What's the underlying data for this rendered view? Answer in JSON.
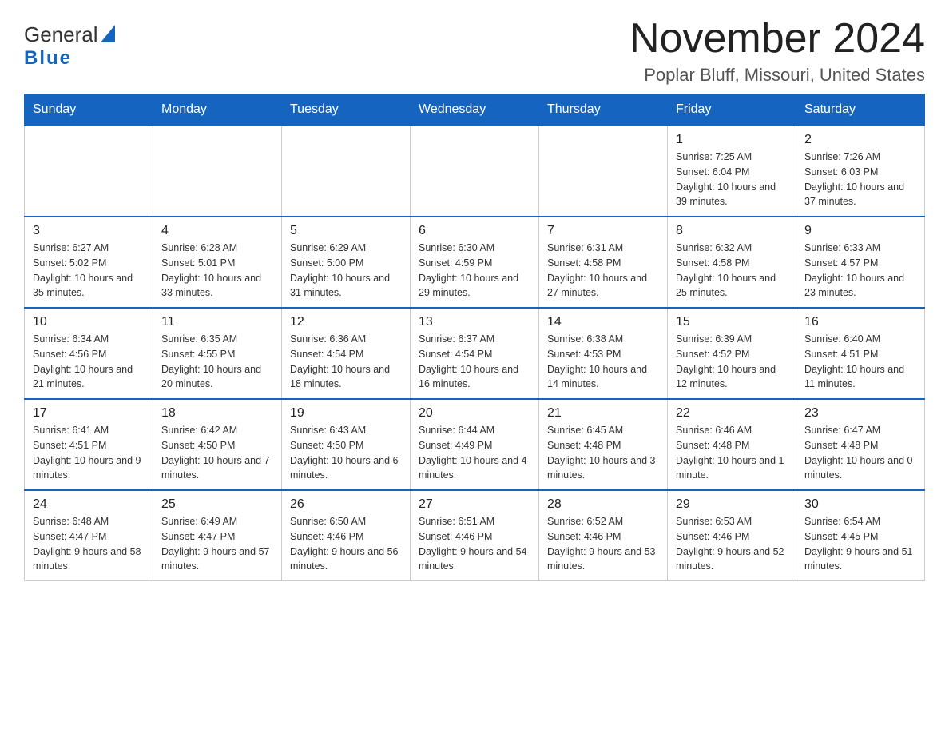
{
  "header": {
    "logo_general": "General",
    "logo_blue": "Blue",
    "title": "November 2024",
    "subtitle": "Poplar Bluff, Missouri, United States"
  },
  "calendar": {
    "days_of_week": [
      "Sunday",
      "Monday",
      "Tuesday",
      "Wednesday",
      "Thursday",
      "Friday",
      "Saturday"
    ],
    "weeks": [
      [
        {
          "day": "",
          "info": ""
        },
        {
          "day": "",
          "info": ""
        },
        {
          "day": "",
          "info": ""
        },
        {
          "day": "",
          "info": ""
        },
        {
          "day": "",
          "info": ""
        },
        {
          "day": "1",
          "info": "Sunrise: 7:25 AM\nSunset: 6:04 PM\nDaylight: 10 hours and 39 minutes."
        },
        {
          "day": "2",
          "info": "Sunrise: 7:26 AM\nSunset: 6:03 PM\nDaylight: 10 hours and 37 minutes."
        }
      ],
      [
        {
          "day": "3",
          "info": "Sunrise: 6:27 AM\nSunset: 5:02 PM\nDaylight: 10 hours and 35 minutes."
        },
        {
          "day": "4",
          "info": "Sunrise: 6:28 AM\nSunset: 5:01 PM\nDaylight: 10 hours and 33 minutes."
        },
        {
          "day": "5",
          "info": "Sunrise: 6:29 AM\nSunset: 5:00 PM\nDaylight: 10 hours and 31 minutes."
        },
        {
          "day": "6",
          "info": "Sunrise: 6:30 AM\nSunset: 4:59 PM\nDaylight: 10 hours and 29 minutes."
        },
        {
          "day": "7",
          "info": "Sunrise: 6:31 AM\nSunset: 4:58 PM\nDaylight: 10 hours and 27 minutes."
        },
        {
          "day": "8",
          "info": "Sunrise: 6:32 AM\nSunset: 4:58 PM\nDaylight: 10 hours and 25 minutes."
        },
        {
          "day": "9",
          "info": "Sunrise: 6:33 AM\nSunset: 4:57 PM\nDaylight: 10 hours and 23 minutes."
        }
      ],
      [
        {
          "day": "10",
          "info": "Sunrise: 6:34 AM\nSunset: 4:56 PM\nDaylight: 10 hours and 21 minutes."
        },
        {
          "day": "11",
          "info": "Sunrise: 6:35 AM\nSunset: 4:55 PM\nDaylight: 10 hours and 20 minutes."
        },
        {
          "day": "12",
          "info": "Sunrise: 6:36 AM\nSunset: 4:54 PM\nDaylight: 10 hours and 18 minutes."
        },
        {
          "day": "13",
          "info": "Sunrise: 6:37 AM\nSunset: 4:54 PM\nDaylight: 10 hours and 16 minutes."
        },
        {
          "day": "14",
          "info": "Sunrise: 6:38 AM\nSunset: 4:53 PM\nDaylight: 10 hours and 14 minutes."
        },
        {
          "day": "15",
          "info": "Sunrise: 6:39 AM\nSunset: 4:52 PM\nDaylight: 10 hours and 12 minutes."
        },
        {
          "day": "16",
          "info": "Sunrise: 6:40 AM\nSunset: 4:51 PM\nDaylight: 10 hours and 11 minutes."
        }
      ],
      [
        {
          "day": "17",
          "info": "Sunrise: 6:41 AM\nSunset: 4:51 PM\nDaylight: 10 hours and 9 minutes."
        },
        {
          "day": "18",
          "info": "Sunrise: 6:42 AM\nSunset: 4:50 PM\nDaylight: 10 hours and 7 minutes."
        },
        {
          "day": "19",
          "info": "Sunrise: 6:43 AM\nSunset: 4:50 PM\nDaylight: 10 hours and 6 minutes."
        },
        {
          "day": "20",
          "info": "Sunrise: 6:44 AM\nSunset: 4:49 PM\nDaylight: 10 hours and 4 minutes."
        },
        {
          "day": "21",
          "info": "Sunrise: 6:45 AM\nSunset: 4:48 PM\nDaylight: 10 hours and 3 minutes."
        },
        {
          "day": "22",
          "info": "Sunrise: 6:46 AM\nSunset: 4:48 PM\nDaylight: 10 hours and 1 minute."
        },
        {
          "day": "23",
          "info": "Sunrise: 6:47 AM\nSunset: 4:48 PM\nDaylight: 10 hours and 0 minutes."
        }
      ],
      [
        {
          "day": "24",
          "info": "Sunrise: 6:48 AM\nSunset: 4:47 PM\nDaylight: 9 hours and 58 minutes."
        },
        {
          "day": "25",
          "info": "Sunrise: 6:49 AM\nSunset: 4:47 PM\nDaylight: 9 hours and 57 minutes."
        },
        {
          "day": "26",
          "info": "Sunrise: 6:50 AM\nSunset: 4:46 PM\nDaylight: 9 hours and 56 minutes."
        },
        {
          "day": "27",
          "info": "Sunrise: 6:51 AM\nSunset: 4:46 PM\nDaylight: 9 hours and 54 minutes."
        },
        {
          "day": "28",
          "info": "Sunrise: 6:52 AM\nSunset: 4:46 PM\nDaylight: 9 hours and 53 minutes."
        },
        {
          "day": "29",
          "info": "Sunrise: 6:53 AM\nSunset: 4:46 PM\nDaylight: 9 hours and 52 minutes."
        },
        {
          "day": "30",
          "info": "Sunrise: 6:54 AM\nSunset: 4:45 PM\nDaylight: 9 hours and 51 minutes."
        }
      ]
    ]
  }
}
